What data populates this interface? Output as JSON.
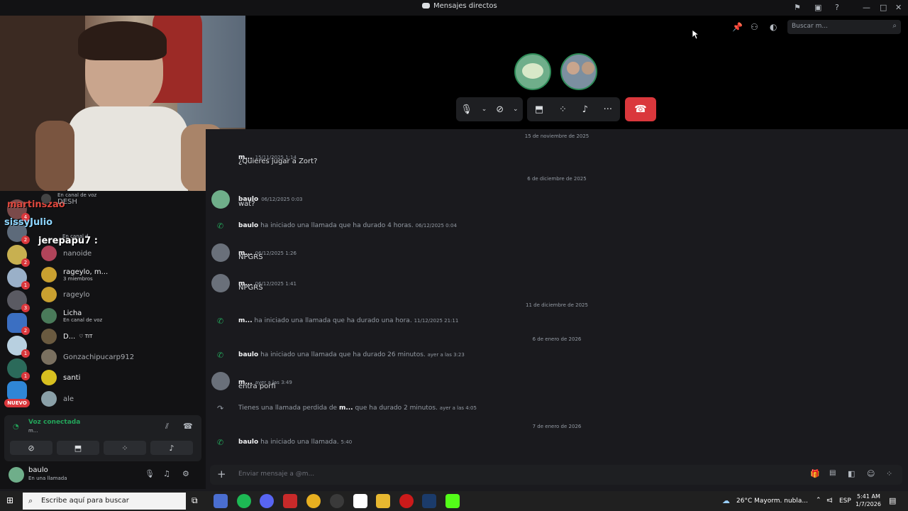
{
  "window": {
    "title": "Mensajes directos"
  },
  "search": {
    "placeholder": "Buscar m..."
  },
  "stream_overlay": {
    "chat_names": [
      "martinszao",
      "sissyJulio",
      "jerepapu7 :"
    ]
  },
  "sidebar": {
    "badges": [
      "4",
      "2",
      "2",
      "1",
      "3",
      "2",
      "1",
      "1",
      "NUEVO"
    ],
    "dms": [
      {
        "name": "",
        "sub": "En canal de voz",
        "extra": "DESH"
      },
      {
        "name": "nanoide",
        "sub": ""
      },
      {
        "name": "rageylo, m...",
        "sub": "3 miembros"
      },
      {
        "name": "rageylo",
        "sub": ""
      },
      {
        "name": "Licha",
        "sub": "En canal de voz"
      },
      {
        "name": "D...",
        "sub": "",
        "tag": "♡ TIT"
      },
      {
        "name": "Gonzachipucarp912",
        "sub": ""
      },
      {
        "name": "santi",
        "sub": ""
      },
      {
        "name": "ale",
        "sub": ""
      }
    ],
    "extra_sub": "En canal d"
  },
  "voice": {
    "status": "Voz conectada",
    "channel": "m..."
  },
  "user": {
    "name": "baulo",
    "status": "En una llamada"
  },
  "chat": {
    "date1": "15 de noviembre de 2025",
    "msg1": {
      "name": "m...",
      "time": "15/11/2025 1:14",
      "text": "¿Quieres jugar a Zort?"
    },
    "date2": "6 de diciembre de 2025",
    "msg2": {
      "name": "baulo",
      "time": "06/12/2025 0:03",
      "text": "wat?"
    },
    "sys1": {
      "who": "baulo",
      "text": " ha iniciado una llamada que ha durado 4 horas.",
      "time": "06/12/2025 0:04"
    },
    "msg3": {
      "name": "m...",
      "time": "06/12/2025 1:26",
      "text": "NPGRS"
    },
    "msg4": {
      "name": "m...",
      "time": "06/12/2025 1:41",
      "text": "NPGRS"
    },
    "date3": "11 de diciembre de 2025",
    "sys2": {
      "who": "m...",
      "text": " ha iniciado una llamada que ha durado una hora.",
      "time": "11/12/2025 21:11"
    },
    "date4": "6 de enero de 2026",
    "sys3": {
      "who": "baulo",
      "text": " ha iniciado una llamada que ha durado 26 minutos.",
      "time": "ayer a las 3:23"
    },
    "msg5": {
      "name": "m...",
      "time": "ayer a las 3:49",
      "text": "entra porfi"
    },
    "sys4": {
      "pre": "Tienes una llamada perdida de ",
      "who": "m...",
      "text": " que ha durado 2 minutos.",
      "time": "ayer a las 4:05"
    },
    "date5": "7 de enero de 2026",
    "sys5": {
      "who": "baulo",
      "text": " ha iniciado una llamada.",
      "time": "5:40"
    }
  },
  "input": {
    "placeholder": "Enviar mensaje a @m..."
  },
  "taskbar": {
    "search": "Escribe aquí para buscar",
    "weather": "26°C  Mayorm. nubla...",
    "lang": "ESP",
    "time": "5:41 AM",
    "date": "1/7/2026"
  }
}
